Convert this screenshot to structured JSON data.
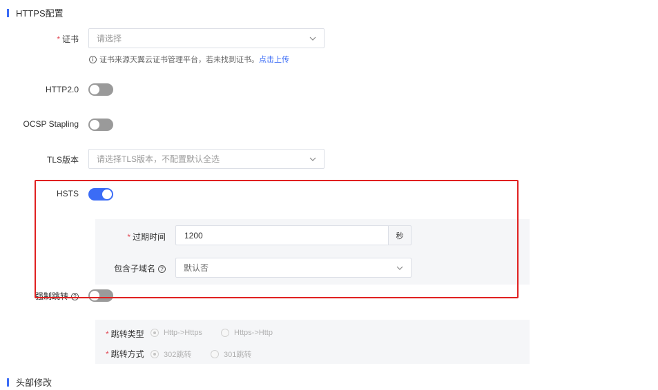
{
  "sections": {
    "https_title": "HTTPS配置",
    "header_title": "头部修改"
  },
  "certificate": {
    "label": "证书",
    "placeholder": "请选择",
    "hint_text": "证书来源天翼云证书管理平台，若未找到证书。",
    "hint_link": "点击上传"
  },
  "http2": {
    "label": "HTTP2.0",
    "enabled": false
  },
  "ocsp": {
    "label": "OCSP Stapling",
    "enabled": false
  },
  "tls": {
    "label": "TLS版本",
    "placeholder": "请选择TLS版本，不配置默认全选"
  },
  "hsts": {
    "label": "HSTS",
    "enabled": true,
    "expire_label": "过期时间",
    "expire_value": "1200",
    "expire_unit": "秒",
    "subdomain_label": "包含子域名",
    "subdomain_value": "默认否"
  },
  "force_redirect": {
    "label": "强制跳转",
    "enabled": false,
    "type_label": "跳转类型",
    "type_options": [
      "Http->Https",
      "Https->Http"
    ],
    "type_selected": "Http->Https",
    "method_label": "跳转方式",
    "method_options": [
      "302跳转",
      "301跳转"
    ],
    "method_selected": "302跳转"
  },
  "colors": {
    "accent": "#3b6cf6",
    "highlight_border": "#e02020",
    "required_mark": "#e34d59"
  }
}
